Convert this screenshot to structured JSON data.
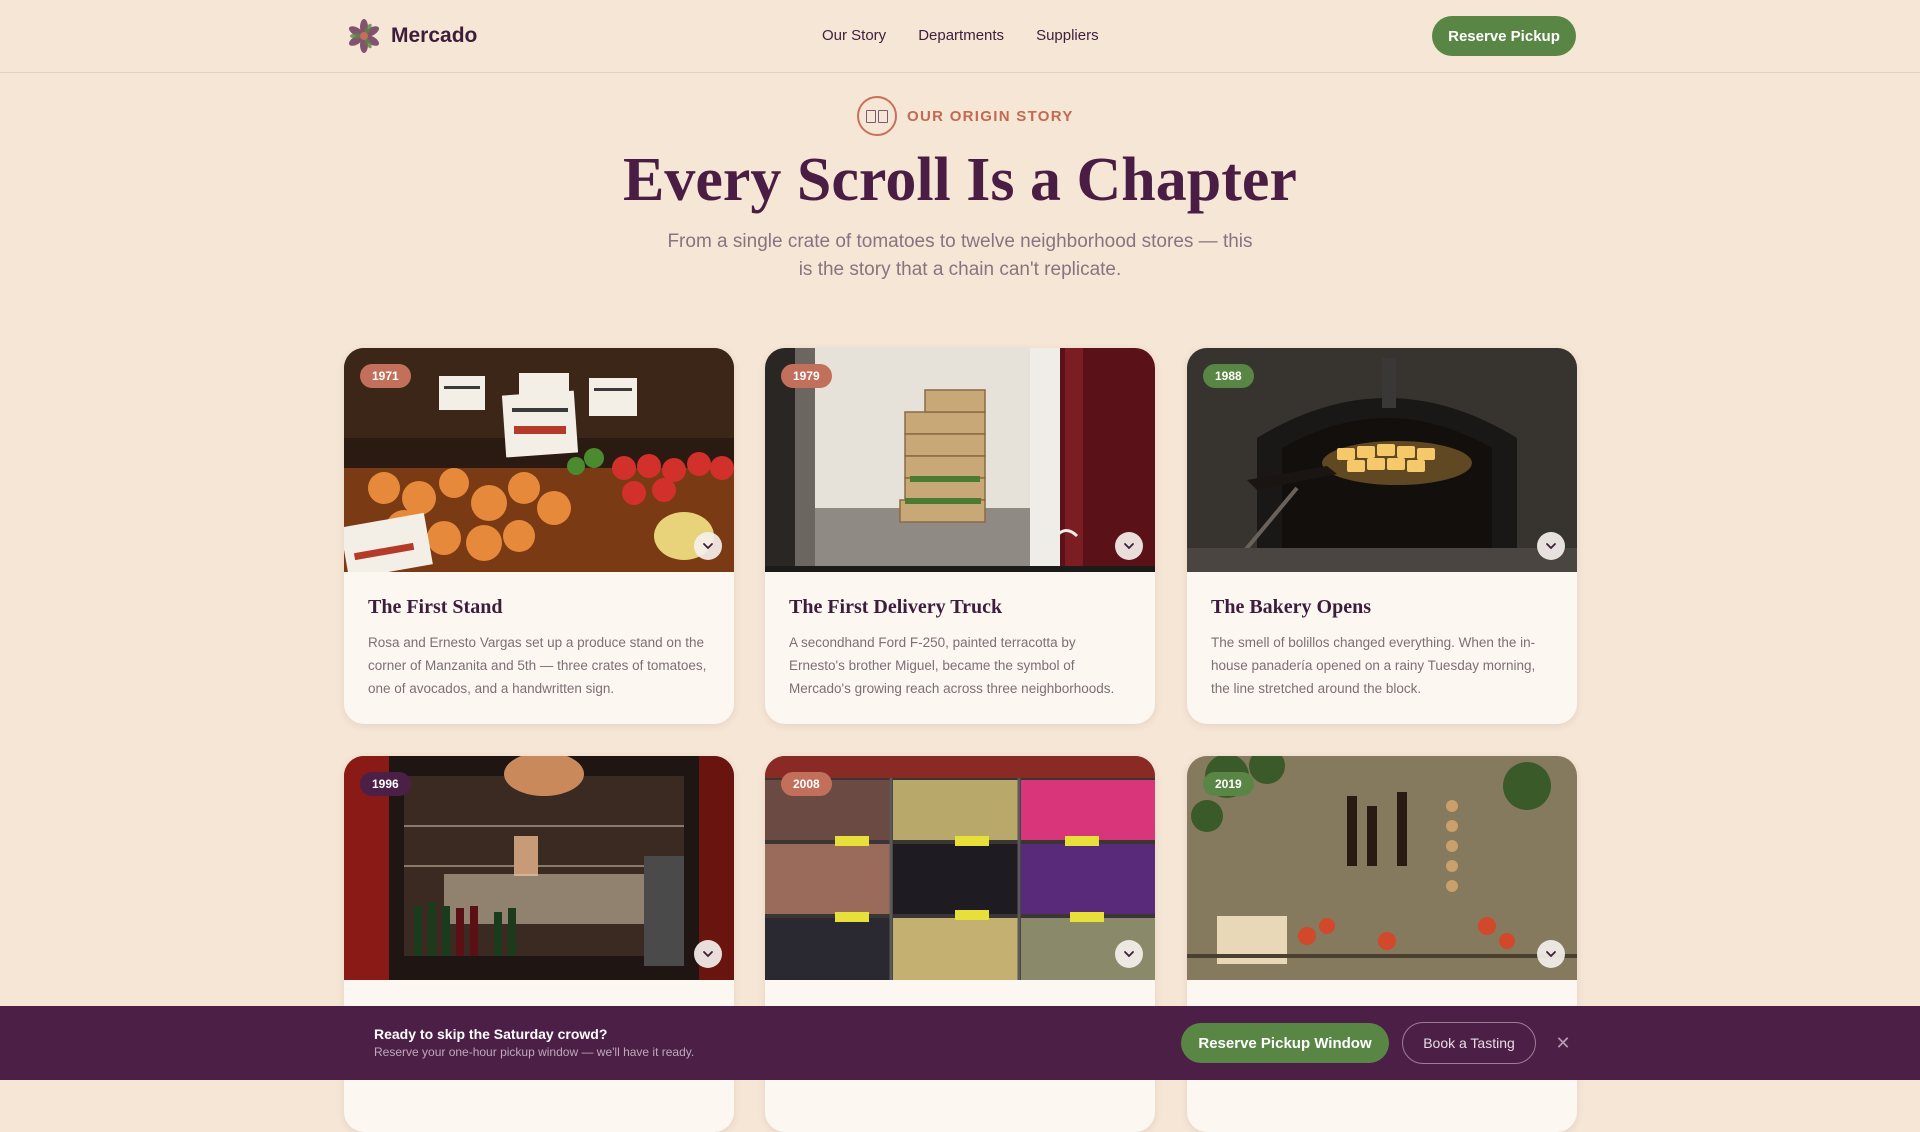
{
  "brand": {
    "name": "Mercado",
    "logo_icon": "flower-logo-icon"
  },
  "nav": {
    "links": [
      "Our Story",
      "Departments",
      "Suppliers"
    ],
    "cta_label": "Reserve Pickup"
  },
  "hero": {
    "eyebrow_icon": "open-book-icon",
    "eyebrow": "OUR ORIGIN STORY",
    "title": "Every Scroll Is a Chapter",
    "subtitle": "From a single crate of tomatoes to twelve neighborhood stores — this is the story that a chain can't replicate."
  },
  "cards": [
    {
      "year": "1971",
      "badge_color": "#c2705c",
      "image": "produce-stand-photo",
      "title": "The First Stand",
      "description": "Rosa and Ernesto Vargas set up a produce stand on the corner of Manzanita and 5th — three crates of tomatoes, one of avocados, and a handwritten sign."
    },
    {
      "year": "1979",
      "badge_color": "#c2705c",
      "image": "delivery-crates-photo",
      "title": "The First Delivery Truck",
      "description": "A secondhand Ford F-250, painted terracotta by Ernesto's brother Miguel, became the symbol of Mercado's growing reach across three neighborhoods."
    },
    {
      "year": "1988",
      "badge_color": "#5a8645",
      "image": "bakery-oven-photo",
      "title": "The Bakery Opens",
      "description": "The smell of bolillos changed everything. When the in-house panadería opened on a rainy Tuesday morning, the line stretched around the block."
    },
    {
      "year": "1996",
      "badge_color": "#4c1f47",
      "image": "deli-counter-photo",
      "title": "",
      "description": ""
    },
    {
      "year": "2008",
      "badge_color": "#c2705c",
      "image": "olive-bins-photo",
      "title": "",
      "description": ""
    },
    {
      "year": "2019",
      "badge_color": "#5a8645",
      "image": "hanging-produce-photo",
      "title": "",
      "description": ""
    }
  ],
  "bottom_bar": {
    "title": "Ready to skip the Saturday crowd?",
    "subtitle": "Reserve your one-hour pickup window — we'll have it ready.",
    "primary_label": "Reserve Pickup Window",
    "secondary_label": "Book a Tasting",
    "close_icon": "close-icon",
    "close_glyph": "✕"
  }
}
